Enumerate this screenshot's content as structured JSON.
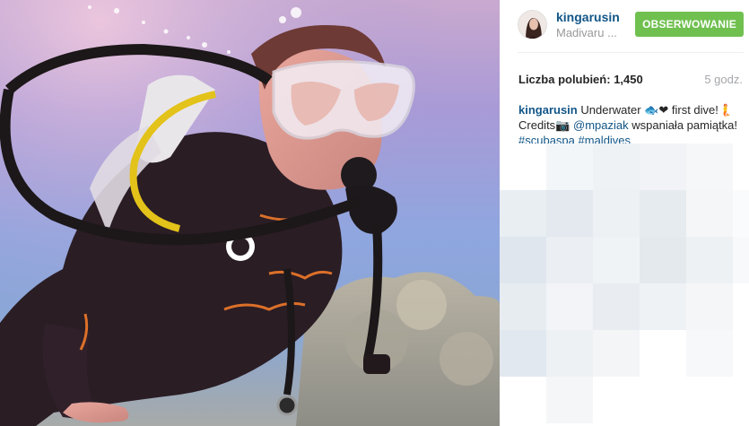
{
  "photo": {
    "alt_subject": "scuba diver underwater"
  },
  "post_header": {
    "username": "kingarusin",
    "location": "Madivaru ...",
    "follow_label": "OBSERWOWANIE"
  },
  "stats": {
    "likes_label": "Liczba polubień:",
    "likes_value": "1,450",
    "time_ago": "5 godz."
  },
  "caption": {
    "username": "kingarusin",
    "text_part1": "Underwater 🐟❤ first dive!🧜",
    "text_part2": "Credits📷",
    "mention": "@mpaziak",
    "text_part3": "wspaniała pamiątka!",
    "hashtag1": "#scubaspa",
    "hashtag2": "#maldives"
  },
  "comments": {
    "first_user": "kingarusin"
  },
  "colors": {
    "accent_link": "#125688",
    "follow_green": "#70c050",
    "muted": "#999999"
  }
}
